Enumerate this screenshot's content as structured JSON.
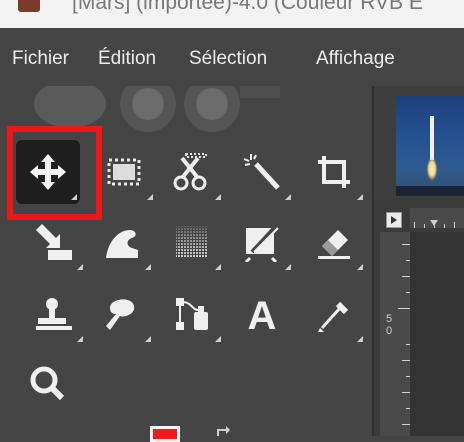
{
  "window": {
    "title": "[Mars] (importée)-4.0 (Couleur RVB E"
  },
  "menubar": {
    "items": [
      {
        "label": "Fichier"
      },
      {
        "label": "Édition"
      },
      {
        "label": "Sélection"
      },
      {
        "label": "Affichage"
      }
    ]
  },
  "toolbox": {
    "active_tool": "move-tool",
    "tools": [
      {
        "icon": "move-icon"
      },
      {
        "icon": "rectangle-select-icon"
      },
      {
        "icon": "scissors-select-icon"
      },
      {
        "icon": "fuzzy-select-wand-icon"
      },
      {
        "icon": "crop-icon"
      },
      {
        "icon": "unified-transform-icon"
      },
      {
        "icon": "warp-transform-icon"
      },
      {
        "icon": "gradient-icon"
      },
      {
        "icon": "paintbrush-icon"
      },
      {
        "icon": "eraser-icon"
      },
      {
        "icon": "clone-stamp-icon"
      },
      {
        "icon": "smudge-icon"
      },
      {
        "icon": "paths-icon"
      },
      {
        "icon": "text-tool-icon"
      },
      {
        "icon": "color-picker-icon"
      },
      {
        "icon": "zoom-icon"
      }
    ],
    "text_tool_glyph": "A",
    "foreground_color": "#ee1c1c",
    "highlight_color": "#f01616"
  },
  "image_window": {
    "ruler_left_label": "5",
    "ruler_left_label2": "0"
  }
}
